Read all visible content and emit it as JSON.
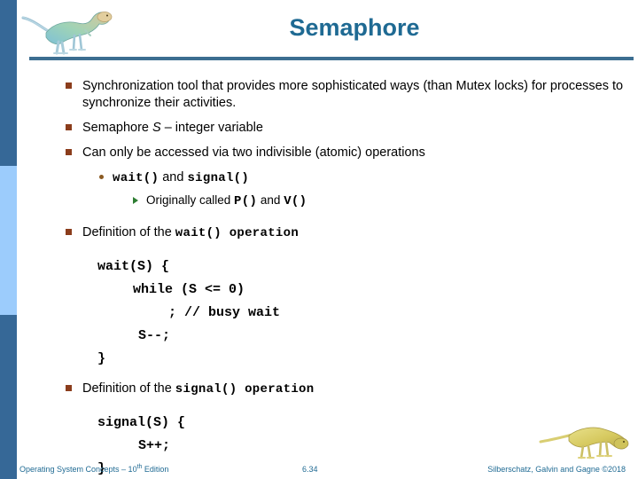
{
  "slide": {
    "title": "Semaphore",
    "accent_color": "#1F6A93",
    "rule_color": "#3C6E91",
    "sidebar_dark": "#366897",
    "sidebar_light": "#9CCCFC",
    "bullet_square_color": "#8B3D1C",
    "bullet_triangle_color": "#2E7D32"
  },
  "bullets": {
    "b1_text": "Synchronization tool that provides more sophisticated ways (than Mutex locks)  for processes to synchronize their activities.",
    "b2_pre": "Semaphore ",
    "b2_var": "S",
    "b2_post": " – integer variable",
    "b3_text": "Can only be accessed via two indivisible (atomic) operations",
    "b4_code1": "wait()",
    "b4_mid": " and ",
    "b4_code2": "signal()",
    "b5_pre": "Originally called ",
    "b5_code1": "P()",
    "b5_mid": " and ",
    "b5_code2": "V()",
    "b6_pre": "Definition of the ",
    "b6_code": "wait() operation",
    "b7_pre": "Definition of the ",
    "b7_code": "signal() operation"
  },
  "wait_code": {
    "line1": "wait(S) {",
    "line2": "while (S <= 0)",
    "line3": "; // busy wait",
    "line4": "S--;",
    "line5": "}"
  },
  "signal_code": {
    "line1": "signal(S) {",
    "line2": "S++;",
    "line3": "}"
  },
  "footer": {
    "left_main": "Operating System Concepts – 10",
    "left_sup": "th",
    "left_tail": " Edition",
    "slide_number": "6.34",
    "right": "Silberschatz, Galvin and Gagne ©2018"
  },
  "icons": {
    "top_logo": "dinosaur-logo",
    "bottom_logo": "dinosaur-logo"
  }
}
